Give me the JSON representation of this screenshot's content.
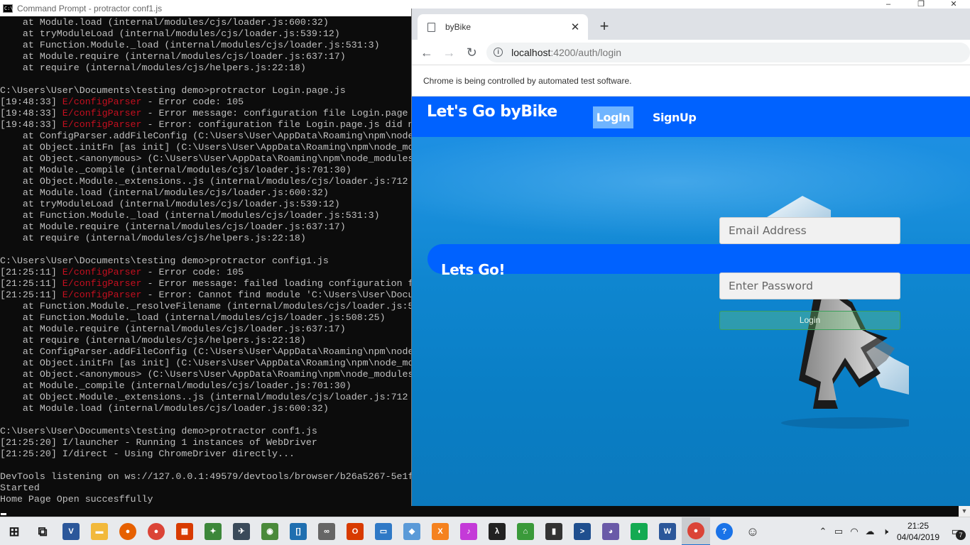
{
  "cmd": {
    "title": "Command Prompt - protractor  conf1.js",
    "lines": [
      {
        "type": "plain",
        "text": "    at Module.load (internal/modules/cjs/loader.js:600:32)"
      },
      {
        "type": "plain",
        "text": "    at tryModuleLoad (internal/modules/cjs/loader.js:539:12)"
      },
      {
        "type": "plain",
        "text": "    at Function.Module._load (internal/modules/cjs/loader.js:531:3)"
      },
      {
        "type": "plain",
        "text": "    at Module.require (internal/modules/cjs/loader.js:637:17)"
      },
      {
        "type": "plain",
        "text": "    at require (internal/modules/cjs/helpers.js:22:18)"
      },
      {
        "type": "plain",
        "text": ""
      },
      {
        "type": "plain",
        "text": "C:\\Users\\User\\Documents\\testing demo>protractor Login.page.js"
      },
      {
        "type": "log",
        "ts": "[19:48:33]",
        "lvl": "E/configParser",
        "msg": " - Error code: 105"
      },
      {
        "type": "log",
        "ts": "[19:48:33]",
        "lvl": "E/configParser",
        "msg": " - Error message: configuration file Login.page"
      },
      {
        "type": "log",
        "ts": "[19:48:33]",
        "lvl": "E/configParser",
        "msg": " - Error: configuration file Login.page.js did n"
      },
      {
        "type": "plain",
        "text": "    at ConfigParser.addFileConfig (C:\\Users\\User\\AppData\\Roaming\\npm\\node_"
      },
      {
        "type": "plain",
        "text": "    at Object.initFn [as init] (C:\\Users\\User\\AppData\\Roaming\\npm\\node_mo"
      },
      {
        "type": "plain",
        "text": "    at Object.<anonymous> (C:\\Users\\User\\AppData\\Roaming\\npm\\node_modules"
      },
      {
        "type": "plain",
        "text": "    at Module._compile (internal/modules/cjs/loader.js:701:30)"
      },
      {
        "type": "plain",
        "text": "    at Object.Module._extensions..js (internal/modules/cjs/loader.js:712"
      },
      {
        "type": "plain",
        "text": "    at Module.load (internal/modules/cjs/loader.js:600:32)"
      },
      {
        "type": "plain",
        "text": "    at tryModuleLoad (internal/modules/cjs/loader.js:539:12)"
      },
      {
        "type": "plain",
        "text": "    at Function.Module._load (internal/modules/cjs/loader.js:531:3)"
      },
      {
        "type": "plain",
        "text": "    at Module.require (internal/modules/cjs/loader.js:637:17)"
      },
      {
        "type": "plain",
        "text": "    at require (internal/modules/cjs/helpers.js:22:18)"
      },
      {
        "type": "plain",
        "text": ""
      },
      {
        "type": "plain",
        "text": "C:\\Users\\User\\Documents\\testing demo>protractor config1.js"
      },
      {
        "type": "log",
        "ts": "[21:25:11]",
        "lvl": "E/configParser",
        "msg": " - Error code: 105"
      },
      {
        "type": "log",
        "ts": "[21:25:11]",
        "lvl": "E/configParser",
        "msg": " - Error message: failed loading configuration f"
      },
      {
        "type": "log",
        "ts": "[21:25:11]",
        "lvl": "E/configParser",
        "msg": " - Error: Cannot find module 'C:\\Users\\User\\Docu"
      },
      {
        "type": "plain",
        "text": "    at Function.Module._resolveFilename (internal/modules/cjs/loader.js:5"
      },
      {
        "type": "plain",
        "text": "    at Function.Module._load (internal/modules/cjs/loader.js:508:25)"
      },
      {
        "type": "plain",
        "text": "    at Module.require (internal/modules/cjs/loader.js:637:17)"
      },
      {
        "type": "plain",
        "text": "    at require (internal/modules/cjs/helpers.js:22:18)"
      },
      {
        "type": "plain",
        "text": "    at ConfigParser.addFileConfig (C:\\Users\\User\\AppData\\Roaming\\npm\\node_"
      },
      {
        "type": "plain",
        "text": "    at Object.initFn [as init] (C:\\Users\\User\\AppData\\Roaming\\npm\\node_mo"
      },
      {
        "type": "plain",
        "text": "    at Object.<anonymous> (C:\\Users\\User\\AppData\\Roaming\\npm\\node_modules"
      },
      {
        "type": "plain",
        "text": "    at Module._compile (internal/modules/cjs/loader.js:701:30)"
      },
      {
        "type": "plain",
        "text": "    at Object.Module._extensions..js (internal/modules/cjs/loader.js:712"
      },
      {
        "type": "plain",
        "text": "    at Module.load (internal/modules/cjs/loader.js:600:32)"
      },
      {
        "type": "plain",
        "text": ""
      },
      {
        "type": "plain",
        "text": "C:\\Users\\User\\Documents\\testing demo>protractor conf1.js"
      },
      {
        "type": "log2",
        "ts": "[21:25:20]",
        "msg": " I/launcher - Running 1 instances of WebDriver"
      },
      {
        "type": "log2",
        "ts": "[21:25:20]",
        "msg": " I/direct - Using ChromeDriver directly..."
      },
      {
        "type": "plain",
        "text": ""
      },
      {
        "type": "plain",
        "text": "DevTools listening on ws://127.0.0.1:49579/devtools/browser/b26a5267-5e1f"
      },
      {
        "type": "plain",
        "text": "Started"
      },
      {
        "type": "plain",
        "text": "Home Page Open succesffully"
      }
    ]
  },
  "browser": {
    "tab_title": "byBike",
    "tab_close": "✕",
    "new_tab": "+",
    "url_host": "localhost",
    "url_path": ":4200/auth/login",
    "infobar_text": "Chrome is being controlled by automated test software."
  },
  "app": {
    "brand": "Let's Go byBike",
    "nav_login": "LogIn",
    "nav_signup": "SignUp",
    "banner_text": "Lets Go!",
    "email_placeholder": "Email Address",
    "password_placeholder": "Enter Password",
    "login_button": "Login"
  },
  "taskbar": {
    "apps": [
      {
        "name": "start-icon",
        "label": "⊞",
        "color": "#1a1a1a"
      },
      {
        "name": "task-view-icon",
        "label": "⧉",
        "color": "#1a1a1a"
      },
      {
        "name": "visual-studio-icon",
        "label": "V",
        "color": "#2b579a"
      },
      {
        "name": "file-explorer-icon",
        "label": "▬",
        "color": "#f2b93b"
      },
      {
        "name": "firefox-icon",
        "label": "●",
        "color": "#e66000"
      },
      {
        "name": "chrome-icon",
        "label": "●",
        "color": "#db4437"
      },
      {
        "name": "office-grid-icon",
        "label": "▦",
        "color": "#d83b01"
      },
      {
        "name": "node-icon",
        "label": "✦",
        "color": "#3c873a"
      },
      {
        "name": "feather-icon",
        "label": "✈",
        "color": "#3a4a5a"
      },
      {
        "name": "globe-icon",
        "label": "◉",
        "color": "#4a8a3a"
      },
      {
        "name": "bracket-app-icon",
        "label": "[]",
        "color": "#1f6fb0"
      },
      {
        "name": "infinity-icon",
        "label": "∞",
        "color": "#666666"
      },
      {
        "name": "office-icon",
        "label": "O",
        "color": "#d83b01"
      },
      {
        "name": "window-app-icon",
        "label": "▭",
        "color": "#2f79c6"
      },
      {
        "name": "cube-icon",
        "label": "◆",
        "color": "#5a9ad8"
      },
      {
        "name": "xampp-icon",
        "label": "X",
        "color": "#f5821f"
      },
      {
        "name": "itunes-icon",
        "label": "♪",
        "color": "#c43ad8"
      },
      {
        "name": "lambda-icon",
        "label": "λ",
        "color": "#222222"
      },
      {
        "name": "house-icon",
        "label": "⌂",
        "color": "#3a9a3a"
      },
      {
        "name": "terminal-icon",
        "label": "▮",
        "color": "#333333"
      },
      {
        "name": "powershell-icon",
        "label": ">",
        "color": "#1f4f8f"
      },
      {
        "name": "github-icon",
        "label": "◕",
        "color": "#6a5aa8"
      },
      {
        "name": "mongodb-icon",
        "label": "◖",
        "color": "#13aa52"
      },
      {
        "name": "word-icon",
        "label": "W",
        "color": "#2b579a"
      },
      {
        "name": "chrome-active-icon",
        "label": "●",
        "color": "#db4437"
      },
      {
        "name": "help-icon",
        "label": "?",
        "color": "#1a73e8"
      },
      {
        "name": "people-icon",
        "label": "☺",
        "color": "#333333"
      }
    ],
    "time": "21:25",
    "date": "04/04/2019",
    "notif_count": "7"
  }
}
